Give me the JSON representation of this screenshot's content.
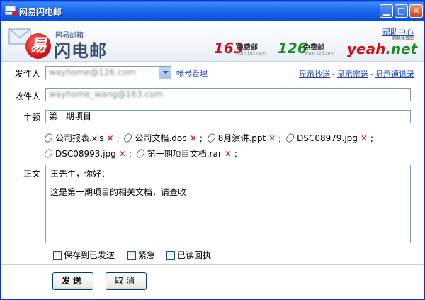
{
  "window": {
    "title": "网易闪电邮",
    "min_symbol": "▁",
    "max_symbol": "□",
    "close_symbol": "✕"
  },
  "header": {
    "logo_sub": "网易邮箱",
    "logo_main": "闪电邮",
    "logo_glyph": "易",
    "help_link": "帮助中心",
    "brand_163": {
      "big": "163",
      "free": "免费邮",
      "url": "mail.163.com"
    },
    "brand_126": {
      "big": "126",
      "free": "免费邮",
      "url": "www.126.com"
    },
    "brand_yeah": {
      "y": "yeah",
      "n": ".net",
      "tag": "网易免费邮"
    }
  },
  "compose": {
    "from_label": "发件人",
    "from_value": "wayhome@126.com",
    "account_manage": "帐号管理",
    "show_cc": "显示抄送",
    "show_bcc": "显示密送",
    "show_contacts": "显示通讯录",
    "link_sep": "-",
    "to_label": "收件人",
    "to_value": "wayhome_wang@163.com",
    "subject_label": "主题",
    "subject_value": "第一期项目",
    "attachments_row1": [
      "公司报表.xls",
      "公司文档.doc",
      "8月演讲.ppt",
      "DSC08979.jpg"
    ],
    "attachments_row2": [
      "DSC08993.jpg",
      "第一期项目文档.rar"
    ],
    "delete_mark": "✕",
    "separator": ";",
    "body_label": "正文",
    "body_lines": [
      "王先生，你好：",
      "这是第一期项目的相关文档，请查收"
    ]
  },
  "options": {
    "save_sent": "保存到已发送",
    "urgent": "紧急",
    "read_receipt": "已读回执"
  },
  "buttons": {
    "send": "发送",
    "cancel": "取消"
  },
  "colors": {
    "titlebar": "#0b55e0",
    "link": "#1a3eb8",
    "delete": "#e01010"
  }
}
